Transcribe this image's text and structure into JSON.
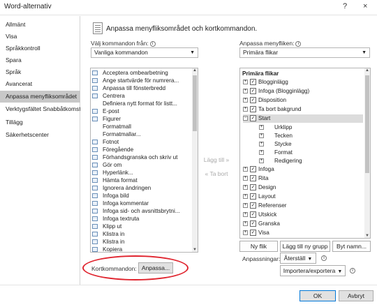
{
  "window": {
    "title": "Word-alternativ",
    "help": "?",
    "close": "×"
  },
  "sidebar": {
    "items": [
      {
        "label": "Allmänt"
      },
      {
        "label": "Visa"
      },
      {
        "label": "Språkkontroll"
      },
      {
        "label": "Spara"
      },
      {
        "label": "Språk"
      },
      {
        "label": "Avancerat"
      },
      {
        "label": "Anpassa menyfliksområdet",
        "selected": true
      },
      {
        "label": "Verktygsfältet Snabbåtkomst"
      },
      {
        "label": "Tillägg"
      },
      {
        "label": "Säkerhetscenter"
      }
    ]
  },
  "main": {
    "title": "Anpassa menyfliksområdet och kortkommandon.",
    "choose_label": "Välj kommandon från:",
    "choose_value": "Vanliga kommandon",
    "customize_label": "Anpassa menyfliken:",
    "customize_value": "Primära flikar",
    "commands": [
      "Acceptera ombearbetning",
      "Ange startvärde för numrera...",
      "Anpassa till fönsterbredd",
      "Centrera",
      "Definiera nytt format för listt...",
      "E-post",
      "Figurer",
      "Formatmall",
      "Formatmallar...",
      "Fotnot",
      "Föregående",
      "Förhandsgranska och skriv ut",
      "Gör om",
      "Hyperlänk...",
      "Hämta format",
      "Ignorera ändringen",
      "Infoga bild",
      "Infoga kommentar",
      "Infoga sid- och avsnittsbrytni...",
      "Infoga textruta",
      "Klipp ut",
      "Klistra in",
      "Klistra in",
      "Kopiera"
    ],
    "add_button": "Lägg till »",
    "remove_button": "« Ta bort",
    "tabs_header": "Primära flikar",
    "tabs": [
      {
        "label": "Blogginlägg",
        "type": "tab"
      },
      {
        "label": "Infoga (Blogginlägg)",
        "type": "tab"
      },
      {
        "label": "Disposition",
        "type": "tab"
      },
      {
        "label": "Ta bort bakgrund",
        "type": "tab"
      },
      {
        "label": "Start",
        "type": "tab",
        "expanded": true,
        "selected": true
      },
      {
        "label": "Urklipp",
        "type": "group"
      },
      {
        "label": "Tecken",
        "type": "group"
      },
      {
        "label": "Stycke",
        "type": "group"
      },
      {
        "label": "Format",
        "type": "group"
      },
      {
        "label": "Redigering",
        "type": "group"
      },
      {
        "label": "Infoga",
        "type": "tab"
      },
      {
        "label": "Rita",
        "type": "tab"
      },
      {
        "label": "Design",
        "type": "tab"
      },
      {
        "label": "Layout",
        "type": "tab"
      },
      {
        "label": "Referenser",
        "type": "tab"
      },
      {
        "label": "Utskick",
        "type": "tab"
      },
      {
        "label": "Granska",
        "type": "tab"
      },
      {
        "label": "Visa",
        "type": "tab"
      }
    ],
    "new_tab": "Ny flik",
    "new_group": "Lägg till ny grupp",
    "rename": "Byt namn...",
    "customizations_label": "Anpassningar:",
    "reset": "Återställ",
    "import_export": "Importera/exportera",
    "shortcuts_label": "Kortkommandon:",
    "customize_button": "Anpassa..."
  },
  "footer": {
    "ok": "OK",
    "cancel": "Avbryt"
  },
  "colors": {
    "annotation_circle": "#e0252f",
    "selected_sidebar": "#c8c8c8",
    "ok_border": "#0078d7"
  }
}
